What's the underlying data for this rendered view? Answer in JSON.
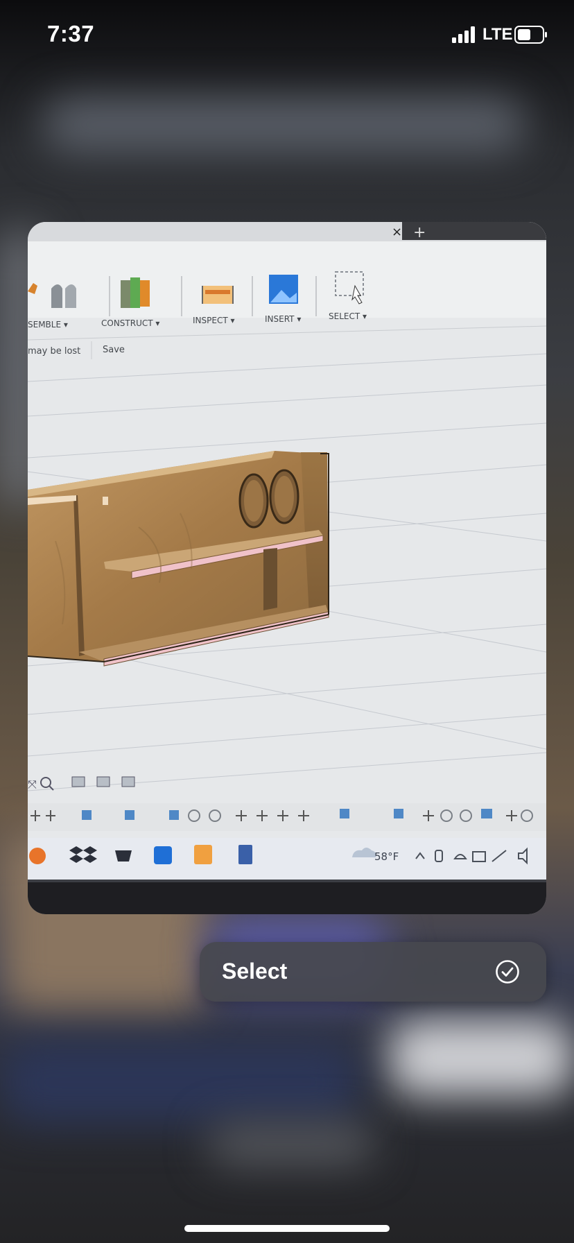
{
  "status_bar": {
    "time": "7:37",
    "carrier": "LTE"
  },
  "preview": {
    "toolbar": {
      "tools": [
        "SEMBLE ▾",
        "CONSTRUCT ▾",
        "INSPECT ▾",
        "INSERT ▾",
        "SELECT ▾"
      ],
      "notice_text": "may be lost",
      "save_label": "Save"
    },
    "taskbar": {
      "temperature": "58°F"
    }
  },
  "select_button": {
    "label": "Select"
  },
  "colors": {
    "accent_pill": "#46484e",
    "wood": "#a9804f"
  }
}
